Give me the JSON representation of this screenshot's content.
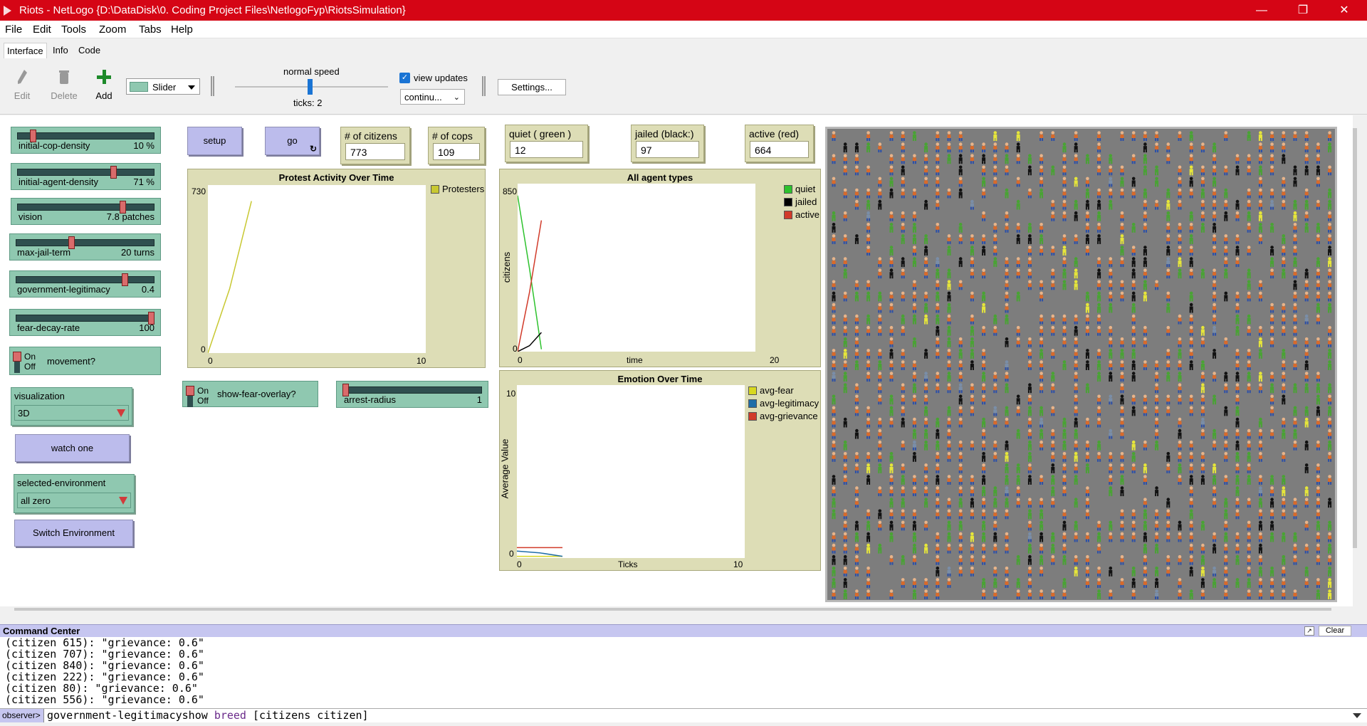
{
  "window": {
    "title": "Riots - NetLogo {D:\\DataDisk\\0. Coding Project Files\\NetlogoFyp\\RiotsSimulation}"
  },
  "menu": [
    "File",
    "Edit",
    "Tools",
    "Zoom",
    "Tabs",
    "Help"
  ],
  "tabs": [
    "Interface",
    "Info",
    "Code"
  ],
  "toolbar": {
    "edit": "Edit",
    "delete": "Delete",
    "add": "Add",
    "widget_type": "Slider",
    "speed_label": "normal speed",
    "ticks": "ticks: 2",
    "view_updates": "view updates",
    "update_mode": "continu...",
    "settings": "Settings..."
  },
  "sliders": [
    {
      "name": "initial-cop-density",
      "value": "10 %",
      "fraction": 0.1
    },
    {
      "name": "initial-agent-density",
      "value": "71 %",
      "fraction": 0.71
    },
    {
      "name": "vision",
      "value": "7.8 patches",
      "fraction": 0.78
    },
    {
      "name": "max-jail-term",
      "value": "20 turns",
      "fraction": 0.4
    },
    {
      "name": "government-legitimacy",
      "value": "0.4",
      "fraction": 0.8
    },
    {
      "name": "fear-decay-rate",
      "value": "100",
      "fraction": 1.0
    },
    {
      "name": "arrest-radius",
      "value": "1",
      "fraction": 0.0
    }
  ],
  "switches": {
    "on": "On",
    "off": "Off",
    "movement": "movement?",
    "fear_overlay": "show-fear-overlay?"
  },
  "buttons": {
    "setup": "setup",
    "go": "go",
    "watch_one": "watch one",
    "switch_env": "Switch Environment"
  },
  "choosers": {
    "visualization": {
      "name": "visualization",
      "value": "3D"
    },
    "environment": {
      "name": "selected-environment",
      "value": "all zero"
    }
  },
  "monitors": [
    {
      "name": "# of citizens",
      "value": "773"
    },
    {
      "name": "# of cops",
      "value": "109"
    },
    {
      "name": "quiet ( green )",
      "value": "12"
    },
    {
      "name": "jailed (black:)",
      "value": "97"
    },
    {
      "name": "active (red)",
      "value": "664"
    }
  ],
  "plots": {
    "protest": {
      "title": "Protest Activity Over Time",
      "ymax": "730",
      "ymin": "0",
      "xmin": "0",
      "xmax": "10",
      "legend": "Protesters"
    },
    "agents": {
      "title": "All agent types",
      "ymax": "850",
      "ymin": "0",
      "xmin": "0",
      "xmax": "20",
      "xlabel": "time",
      "ylabel": "citizens",
      "legend": [
        "quiet",
        "jailed",
        "active"
      ]
    },
    "emotion": {
      "title": "Emotion Over Time",
      "ymax": "10",
      "ymin": "0",
      "xmin": "0",
      "xmax": "10",
      "xlabel": "Ticks",
      "ylabel": "Average Value",
      "legend": [
        "avg-fear",
        "avg-legitimacy",
        "avg-grievance"
      ]
    }
  },
  "chart_data": [
    {
      "type": "line",
      "title": "Protest Activity Over Time",
      "xlim": [
        0,
        10
      ],
      "ylim": [
        0,
        730
      ],
      "series": [
        {
          "name": "Protesters",
          "color": "#c8c832",
          "x": [
            0,
            1,
            2
          ],
          "y": [
            0,
            280,
            660
          ]
        }
      ]
    },
    {
      "type": "line",
      "title": "All agent types",
      "xlabel": "time",
      "ylabel": "citizens",
      "xlim": [
        0,
        20
      ],
      "ylim": [
        0,
        850
      ],
      "series": [
        {
          "name": "quiet",
          "color": "#2dc22d",
          "x": [
            0,
            1,
            2
          ],
          "y": [
            790,
            420,
            12
          ]
        },
        {
          "name": "jailed",
          "color": "#000000",
          "x": [
            0,
            1,
            2
          ],
          "y": [
            0,
            30,
            97
          ]
        },
        {
          "name": "active",
          "color": "#d13b2a",
          "x": [
            0,
            1,
            2
          ],
          "y": [
            0,
            300,
            664
          ]
        }
      ]
    },
    {
      "type": "line",
      "title": "Emotion Over Time",
      "xlabel": "Ticks",
      "ylabel": "Average Value",
      "xlim": [
        0,
        10
      ],
      "ylim": [
        0,
        10
      ],
      "series": [
        {
          "name": "avg-fear",
          "color": "#d8d820",
          "x": [
            0,
            1,
            2
          ],
          "y": [
            0.1,
            0.1,
            0.1
          ]
        },
        {
          "name": "avg-legitimacy",
          "color": "#1f6ea8",
          "x": [
            0,
            1,
            2
          ],
          "y": [
            0.4,
            0.3,
            0.1
          ]
        },
        {
          "name": "avg-grievance",
          "color": "#d13b2a",
          "x": [
            0,
            1,
            2
          ],
          "y": [
            0.6,
            0.6,
            0.6
          ]
        }
      ]
    }
  ],
  "command_center": {
    "title": "Command Center",
    "clear": "Clear",
    "output": [
      "(citizen 615): \"grievance: 0.6\"",
      "(citizen 707): \"grievance: 0.6\"",
      "(citizen 840): \"grievance: 0.6\"",
      "(citizen 222): \"grievance: 0.6\"",
      "(citizen 80): \"grievance: 0.6\"",
      "(citizen 556): \"grievance: 0.6\""
    ],
    "prompt": "observer>",
    "input_a": "government-legitimacyshow ",
    "input_kw": "breed",
    "input_b": " [citizens citizen]"
  },
  "colors": {
    "title_bar": "#d50515",
    "slider": "#8fc8b0",
    "button": "#bcbcec",
    "monitor": "#ddddb6",
    "view_bg": "#7d7d7d"
  }
}
